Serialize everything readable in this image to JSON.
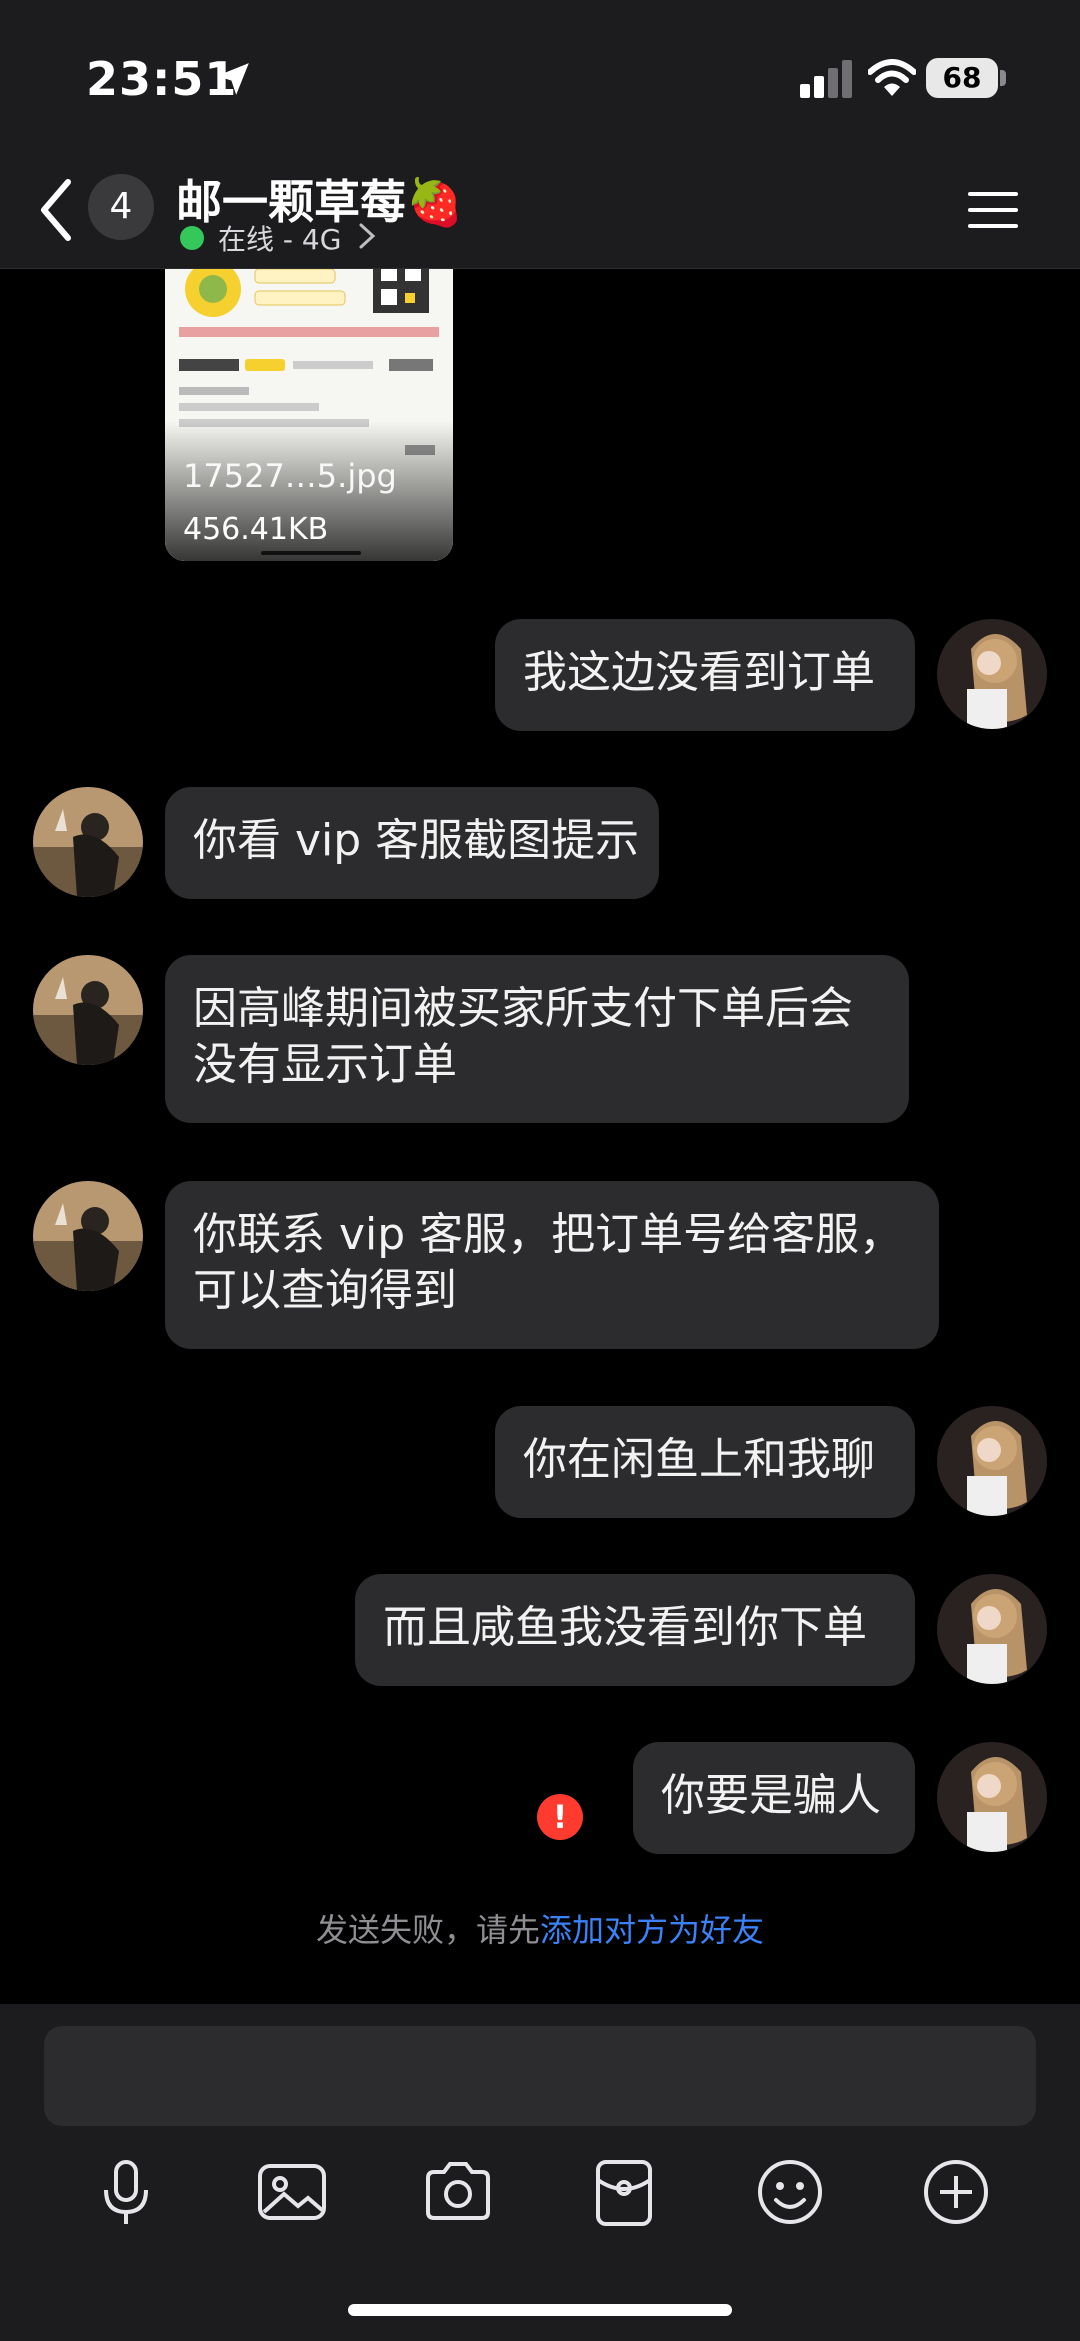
{
  "status_bar": {
    "time": "23:51",
    "battery": "68"
  },
  "header": {
    "unread_count": "4",
    "contact_name": "邮一颗草莓🍓",
    "status_text": "在线 - 4G"
  },
  "image_message": {
    "filename": "17527…5.jpg",
    "size": "456.41KB"
  },
  "messages": [
    {
      "side": "right",
      "text": "我这边没看到订单"
    },
    {
      "side": "left",
      "text": "你看 vip 客服截图提示"
    },
    {
      "side": "left",
      "line1": "因高峰期间被买家所支付下单后会",
      "line2": "没有显示订单"
    },
    {
      "side": "left",
      "line1": "你联系 vip 客服，把订单号给客服，",
      "line2": "可以查询得到"
    },
    {
      "side": "right",
      "text": "你在闲鱼上和我聊"
    },
    {
      "side": "right",
      "text": "而且咸鱼我没看到你下单"
    },
    {
      "side": "right",
      "text": "你要是骗人",
      "failed": true
    }
  ],
  "failure_notice": {
    "prefix": "发送失败，请先",
    "link": "添加对方为好友"
  },
  "input": {
    "placeholder": ""
  },
  "toolbar_icons": [
    "microphone-icon",
    "image-icon",
    "camera-icon",
    "red-packet-icon",
    "emoji-icon",
    "add-icon"
  ],
  "colors": {
    "bubble": "#2c2c2e",
    "online": "#34c759",
    "link": "#3a82f7",
    "error": "#ff3b30"
  }
}
